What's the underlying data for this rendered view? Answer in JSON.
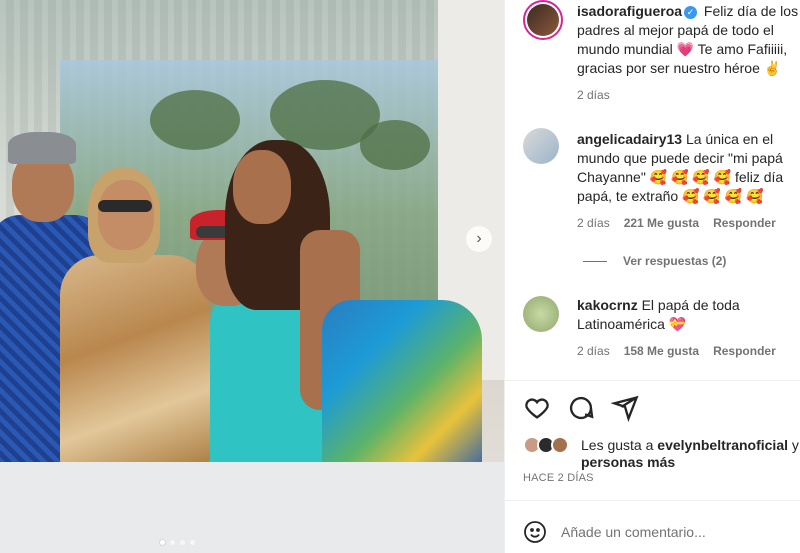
{
  "post": {
    "carousel_total": 4,
    "carousel_active": 1,
    "next_icon": "chevron-right-icon"
  },
  "comments": [
    {
      "username": "isadorafigueroa",
      "verified": true,
      "text": "Feliz día de los padres al mejor papá de todo el mundo mundial 💗 Te amo Fafiiiii, gracias por ser nuestro héroe ✌",
      "time": "2 días"
    },
    {
      "username": "angelicadairy13",
      "text": "La única en el mundo que puede decir \"mi papá Chayanne\" 🥰 🥰 🥰 🥰 feliz día papá, te extraño 🥰 🥰 🥰 🥰",
      "time": "2 días",
      "likes": "221 Me gusta",
      "reply": "Responder",
      "view_replies": "Ver respuestas (2)"
    },
    {
      "username": "kakocrnz",
      "text": "El papá de toda Latinoamérica 💝",
      "time": "2 días",
      "likes": "158 Me gusta",
      "reply": "Responder"
    }
  ],
  "actions": {
    "like_icon": "heart-icon",
    "comment_icon": "comment-bubble-icon",
    "share_icon": "send-icon"
  },
  "likes": {
    "prefix": "Les gusta a ",
    "user": "evelynbeltranoficial",
    "suffix": " y",
    "line2": "personas más"
  },
  "post_date": "HACE 2 DÍAS",
  "add_comment": {
    "placeholder": "Añade un comentario...",
    "emoji_icon": "smiley-icon"
  },
  "colors": {
    "text": "#262626",
    "secondary": "#737373",
    "verified": "#3897f0"
  }
}
